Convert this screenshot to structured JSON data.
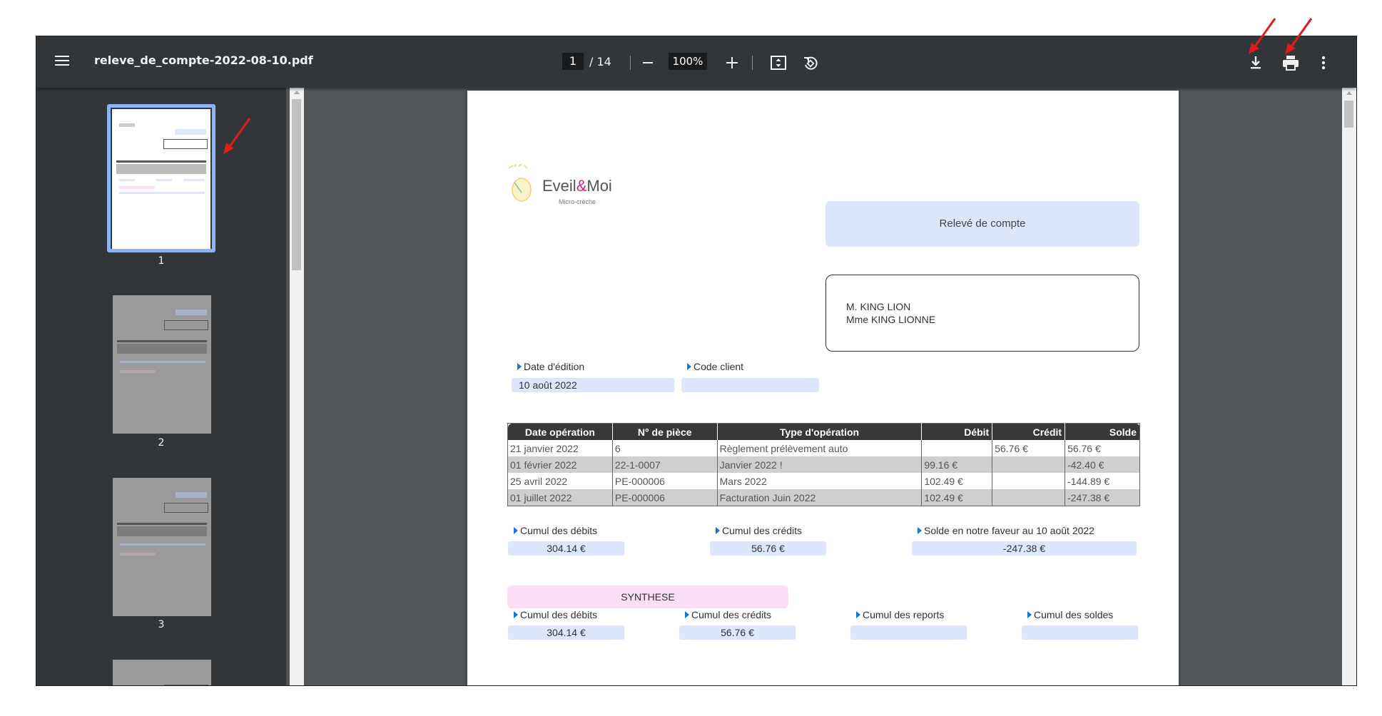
{
  "toolbar": {
    "file_name": "releve_de_compte-2022-08-10.pdf",
    "current_page": "1",
    "total_pages": "/ 14",
    "zoom": "100%"
  },
  "sidebar": {
    "thumbnails": [
      {
        "number": "1",
        "selected": true
      },
      {
        "number": "2",
        "selected": false
      },
      {
        "number": "3",
        "selected": false
      }
    ]
  },
  "document": {
    "logo_name_prefix": "Eveil",
    "logo_name_amp": "&",
    "logo_name_suffix": "Moi",
    "logo_subtitle": "Micro-crèche",
    "statement_title": "Relevé de compte",
    "address": [
      "M. KING LION",
      "Mme KING LIONNE"
    ],
    "edition_date_label": "Date d'édition",
    "edition_date_value": "10 août 2022",
    "client_code_label": "Code client",
    "client_code_value": "",
    "table": {
      "headers": [
        "Date opération",
        "N° de pièce",
        "Type d'opération",
        "Débit",
        "Crédit",
        "Solde"
      ],
      "rows": [
        [
          "21 janvier 2022",
          "6",
          "Règlement prélèvement auto",
          "",
          "56.76 €",
          "56.76 €"
        ],
        [
          "01 février 2022",
          "22-1-0007",
          "Janvier 2022 !",
          "99.16 €",
          "",
          "-42.40 €"
        ],
        [
          "25 avril 2022",
          "PE-000006",
          "Mars 2022",
          "102.49 €",
          "",
          "-144.89 €"
        ],
        [
          "01 juillet 2022",
          "PE-000006",
          "Facturation Juin 2022",
          "102.49 €",
          "",
          "-247.38 €"
        ]
      ]
    },
    "totals": {
      "debits_label": "Cumul des débits",
      "debits_value": "304.14 €",
      "credits_label": "Cumul des crédits",
      "credits_value": "56.76 €",
      "balance_label": "Solde en notre faveur au 10 août 2022",
      "balance_value": "-247.38 €"
    },
    "synthese": {
      "title": "SYNTHESE",
      "debits_label": "Cumul des débits",
      "debits_value": "304.14 €",
      "credits_label": "Cumul des crédits",
      "credits_value": "56.76 €",
      "reports_label": "Cumul des reports",
      "reports_value": "",
      "balances_label": "Cumul des soldes",
      "balances_value": ""
    }
  },
  "colors": {
    "toolbar_bg": "#323639",
    "viewer_bg": "#525659",
    "field_blue": "#dde6fd",
    "synth_pink": "#fbdff5",
    "annotation_red": "#e01b1b"
  }
}
